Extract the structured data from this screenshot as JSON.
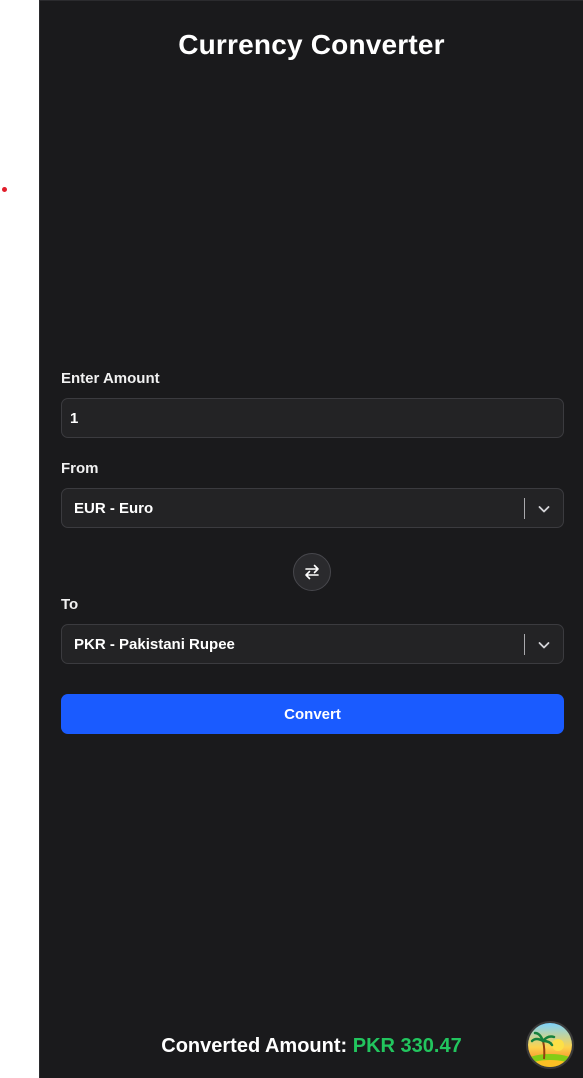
{
  "app": {
    "title": "Currency Converter"
  },
  "amount": {
    "label": "Enter Amount",
    "value": "1"
  },
  "from": {
    "label": "From",
    "selected": "EUR - Euro"
  },
  "to": {
    "label": "To",
    "selected": "PKR - Pakistani Rupee"
  },
  "convert": {
    "label": "Convert"
  },
  "result": {
    "label": "Converted Amount: ",
    "value": "PKR 330.47"
  },
  "icons": {
    "swap": "swap-arrows-icon",
    "chevron": "chevron-down-icon",
    "avatar": "tropical-island-avatar"
  },
  "colors": {
    "panel_bg": "#1a1a1c",
    "accent": "#1a5bff",
    "result_value": "#22c55e"
  }
}
